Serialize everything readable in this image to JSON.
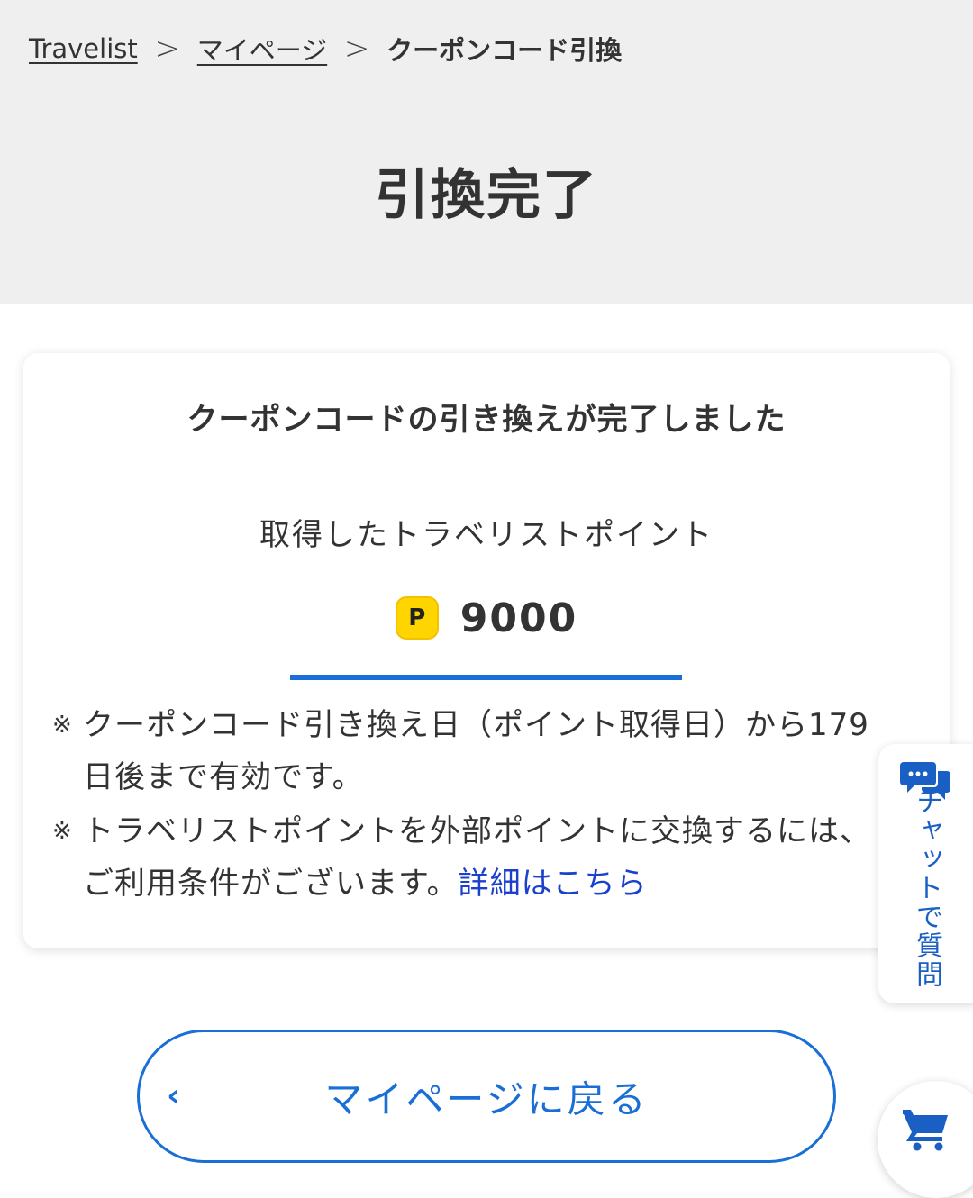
{
  "breadcrumb": {
    "items": [
      "Travelist",
      "マイページ",
      "クーポンコード引換"
    ],
    "separator": ">"
  },
  "page_title": "引換完了",
  "card": {
    "heading": "クーポンコードの引き換えが完了しました",
    "points_label": "取得したトラベリストポイント",
    "points_badge": "P",
    "points_value": "9000",
    "notes": [
      {
        "mark": "※",
        "text": "クーポンコード引き換え日（ポイント取得日）から179日後まで有効です。"
      },
      {
        "mark": "※",
        "text": "トラベリストポイントを外部ポイントに交換するには、ご利用条件がございます。",
        "link": "詳細はこちら"
      }
    ]
  },
  "back_button": {
    "chevron": "‹",
    "label": "マイページに戻る"
  },
  "chat_tab": {
    "icon": "chat-bubbles-icon",
    "label": "チャットで質問"
  },
  "cart": {
    "icon": "cart-icon"
  },
  "colors": {
    "accent_blue": "#1a6fd6",
    "link_blue": "#1a40cc",
    "badge_yellow": "#ffd500",
    "header_gray": "#efefef"
  }
}
